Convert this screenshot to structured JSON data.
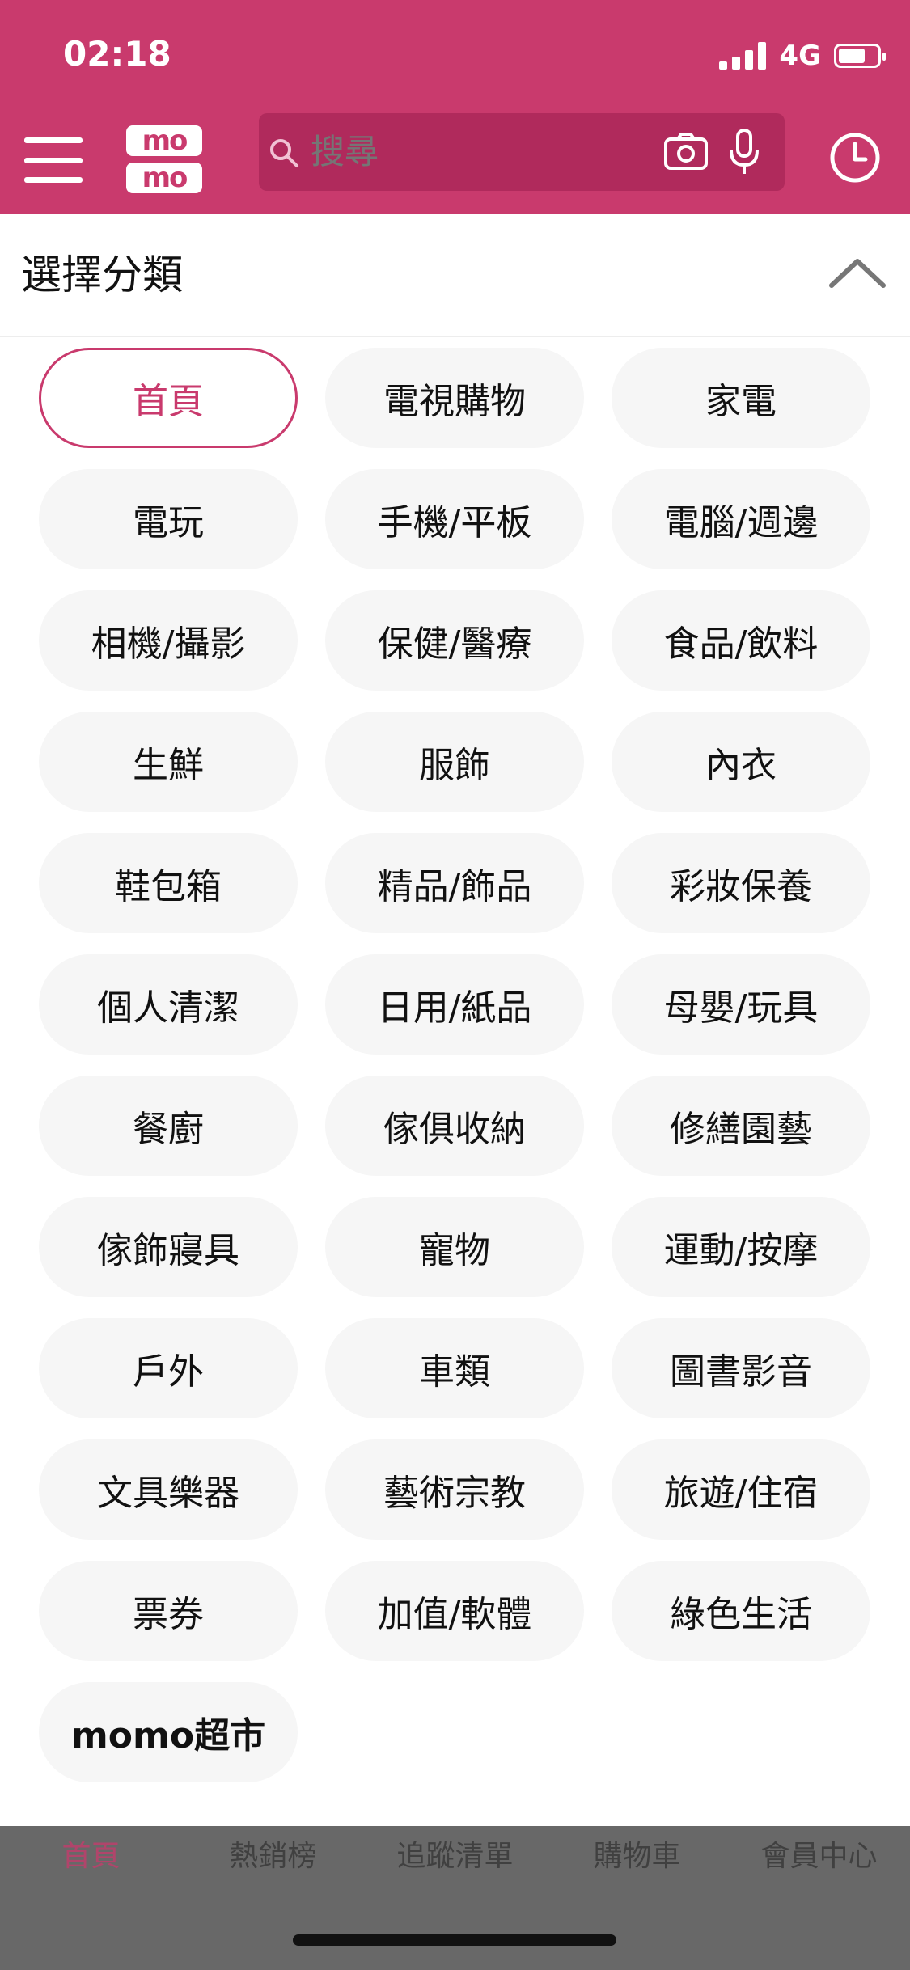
{
  "status_bar": {
    "time": "02:18",
    "network": "4G",
    "battery_level": 0.7
  },
  "header": {
    "logo_top": "mo",
    "logo_bottom": "mo",
    "search": {
      "placeholder": "搜尋"
    },
    "icons": {
      "menu": "menu-icon",
      "search": "search-icon",
      "camera": "camera-icon",
      "mic": "microphone-icon",
      "history": "clock-icon"
    },
    "accent_color": "#c93a6d"
  },
  "category_section": {
    "title": "選擇分類",
    "collapse_icon": "chevron-up-icon"
  },
  "categories": [
    {
      "label": "首頁",
      "active": true
    },
    {
      "label": "電視購物"
    },
    {
      "label": "家電"
    },
    {
      "label": "電玩"
    },
    {
      "label": "手機/平板"
    },
    {
      "label": "電腦/週邊"
    },
    {
      "label": "相機/攝影"
    },
    {
      "label": "保健/醫療"
    },
    {
      "label": "食品/飲料"
    },
    {
      "label": "生鮮"
    },
    {
      "label": "服飾"
    },
    {
      "label": "內衣"
    },
    {
      "label": "鞋包箱"
    },
    {
      "label": "精品/飾品"
    },
    {
      "label": "彩妝保養"
    },
    {
      "label": "個人清潔"
    },
    {
      "label": "日用/紙品"
    },
    {
      "label": "母嬰/玩具"
    },
    {
      "label": "餐廚"
    },
    {
      "label": "傢俱收納"
    },
    {
      "label": "修繕園藝"
    },
    {
      "label": "傢飾寢具"
    },
    {
      "label": "寵物"
    },
    {
      "label": "運動/按摩"
    },
    {
      "label": "戶外"
    },
    {
      "label": "車類"
    },
    {
      "label": "圖書影音"
    },
    {
      "label": "文具樂器"
    },
    {
      "label": "藝術宗教"
    },
    {
      "label": "旅遊/住宿"
    },
    {
      "label": "票券"
    },
    {
      "label": "加值/軟體"
    },
    {
      "label": "綠色生活"
    },
    {
      "label": "momo超市",
      "bold": true
    }
  ],
  "bottom_tabs": [
    {
      "label": "首頁",
      "color": "#c93a6d"
    },
    {
      "label": "熱銷榜",
      "color": "#333333"
    },
    {
      "label": "追蹤清單",
      "color": "#333333"
    },
    {
      "label": "購物車",
      "color": "#333333"
    },
    {
      "label": "會員中心",
      "color": "#333333"
    }
  ]
}
